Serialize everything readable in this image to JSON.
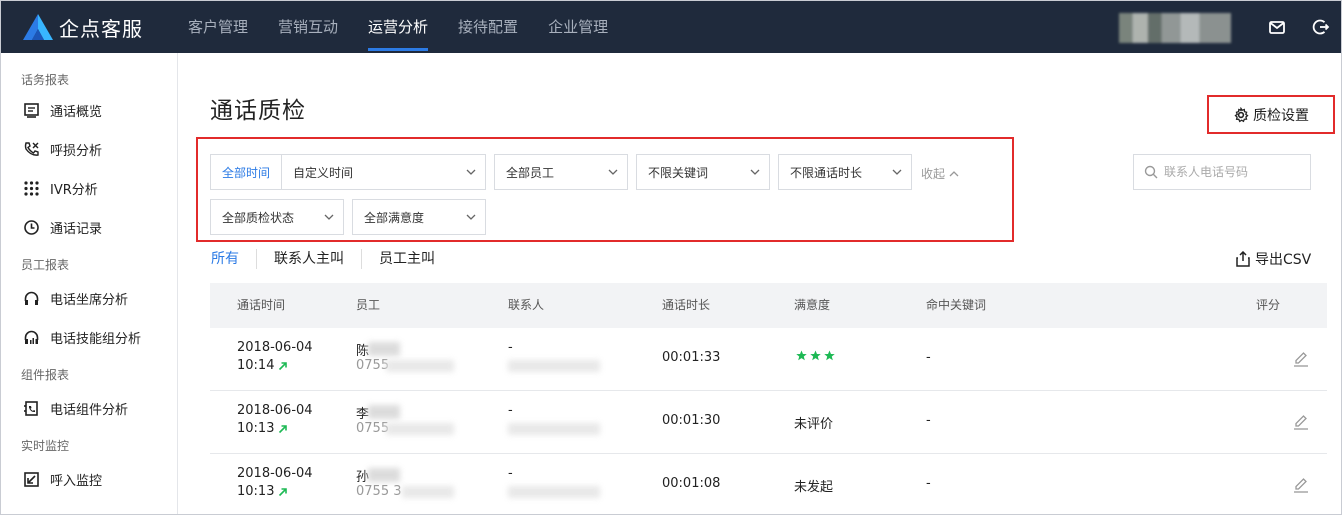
{
  "app": {
    "brand": "企点客服",
    "accent": "#2c7be5",
    "alert_border": "#e22b2b",
    "topbar_bg": "#1f2a3c"
  },
  "nav": {
    "items": [
      {
        "label": "客户管理",
        "active": false
      },
      {
        "label": "营销互动",
        "active": false
      },
      {
        "label": "运营分析",
        "active": true
      },
      {
        "label": "接待配置",
        "active": false
      },
      {
        "label": "企业管理",
        "active": false
      }
    ],
    "icons": [
      "mail-icon",
      "logout-icon"
    ]
  },
  "sidebar": {
    "groups": [
      {
        "title": "话务报表",
        "items": [
          {
            "label": "通话概览",
            "icon": "overview-icon"
          },
          {
            "label": "呼损分析",
            "icon": "missed-call-icon"
          },
          {
            "label": "IVR分析",
            "icon": "ivr-keypad-icon"
          },
          {
            "label": "通话记录",
            "icon": "clock-icon"
          }
        ]
      },
      {
        "title": "员工报表",
        "items": [
          {
            "label": "电话坐席分析",
            "icon": "headset-icon"
          },
          {
            "label": "电话技能组分析",
            "icon": "headset-chart-icon"
          }
        ]
      },
      {
        "title": "组件报表",
        "items": [
          {
            "label": "电话组件分析",
            "icon": "widget-icon"
          }
        ]
      },
      {
        "title": "实时监控",
        "items": [
          {
            "label": "呼入监控",
            "icon": "inbound-icon"
          }
        ]
      }
    ]
  },
  "page": {
    "title": "通话质检",
    "settings_label": "质检设置"
  },
  "filters": {
    "time_range": "全部时间",
    "custom_time": "自定义时间",
    "employee": "全部员工",
    "keyword": "不限关键词",
    "duration": "不限通话时长",
    "collapse": "收起",
    "qc_status": "全部质检状态",
    "satisfaction": "全部满意度",
    "search_placeholder": "联系人电话号码"
  },
  "tabs": [
    {
      "label": "所有",
      "active": true
    },
    {
      "label": "联系人主叫",
      "active": false
    },
    {
      "label": "员工主叫",
      "active": false
    }
  ],
  "export_label": "导出CSV",
  "table": {
    "columns": [
      "通话时间",
      "员工",
      "联系人",
      "通话时长",
      "满意度",
      "命中关键词",
      "评分"
    ],
    "rows": [
      {
        "date": "2018-06-04",
        "time": "10:14",
        "employee": "陈",
        "employee_phone": "0755",
        "contact": "-",
        "duration": "00:01:33",
        "satisfaction": "",
        "satisfaction_stars": 3,
        "keywords": "-"
      },
      {
        "date": "2018-06-04",
        "time": "10:13",
        "employee": "李",
        "employee_phone": "0755",
        "contact": "-",
        "duration": "00:01:30",
        "satisfaction": "未评价",
        "satisfaction_stars": 0,
        "keywords": "-"
      },
      {
        "date": "2018-06-04",
        "time": "10:13",
        "employee": "孙",
        "employee_phone": "0755 3",
        "contact": "-",
        "duration": "00:01:08",
        "satisfaction": "未发起",
        "satisfaction_stars": 0,
        "keywords": "-"
      }
    ]
  }
}
